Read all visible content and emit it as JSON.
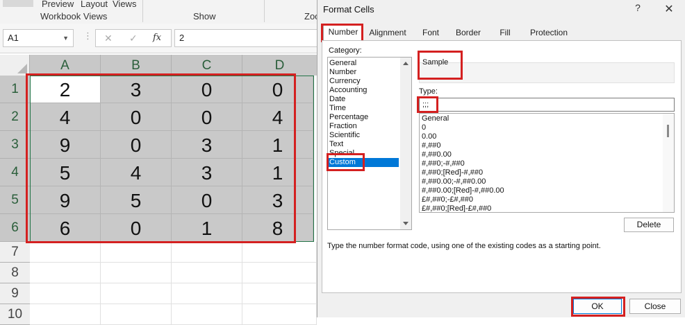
{
  "ribbon": {
    "preview_label": "Preview",
    "layout_label": "Layout",
    "views_label": "Views",
    "workbook_views_label": "Workbook Views",
    "show_label": "Show",
    "zoom_label": "Zoo"
  },
  "formula_bar": {
    "name_box": "A1",
    "fx_label": "fx",
    "value": "2"
  },
  "grid": {
    "columns": [
      "A",
      "B",
      "C",
      "D"
    ],
    "rows": [
      "1",
      "2",
      "3",
      "4",
      "5",
      "6",
      "7",
      "8",
      "9",
      "10"
    ],
    "cells": [
      [
        "2",
        "3",
        "0",
        "0"
      ],
      [
        "4",
        "0",
        "0",
        "4"
      ],
      [
        "9",
        "0",
        "3",
        "1"
      ],
      [
        "5",
        "4",
        "3",
        "1"
      ],
      [
        "9",
        "5",
        "0",
        "3"
      ],
      [
        "6",
        "0",
        "1",
        "8"
      ]
    ]
  },
  "dialog": {
    "title": "Format Cells",
    "help_label": "?",
    "close_label": "✕",
    "tabs": [
      "Number",
      "Alignment",
      "Font",
      "Border",
      "Fill",
      "Protection"
    ],
    "category_label": "Category:",
    "categories": [
      "General",
      "Number",
      "Currency",
      "Accounting",
      "Date",
      "Time",
      "Percentage",
      "Fraction",
      "Scientific",
      "Text",
      "Special",
      "Custom"
    ],
    "selected_category": "Custom",
    "sample_label": "Sample",
    "type_label": "Type:",
    "type_value": ";;;",
    "formats": [
      "General",
      "0",
      "0.00",
      "#,##0",
      "#,##0.00",
      "#,##0;-#,##0",
      "#,##0;[Red]-#,##0",
      "#,##0.00;-#,##0.00",
      "#,##0.00;[Red]-#,##0.00",
      "£#,##0;-£#,##0",
      "£#,##0;[Red]-£#,##0"
    ],
    "delete_label": "Delete",
    "hint": "Type the number format code, using one of the existing codes as a starting point.",
    "ok_label": "OK",
    "close_button_label": "Close"
  },
  "colors": {
    "highlight_red": "#d42020",
    "selection_blue": "#0078d7",
    "header_green": "#2a5e3a"
  }
}
